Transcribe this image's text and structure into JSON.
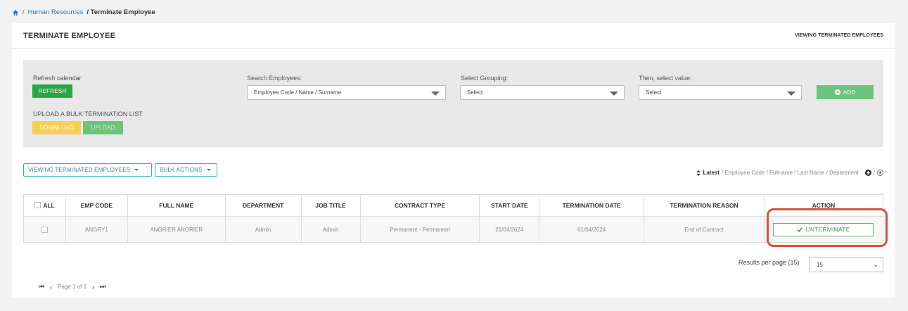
{
  "breadcrumb": {
    "separator": "/",
    "link": "Human Resources",
    "current": "/ Terminate Employee"
  },
  "card": {
    "title": "TERMINATE EMPLOYEE",
    "subtitle": "VIEWING TERMINATED EMPLOYEES"
  },
  "filters": {
    "refresh_label": "Refresh calendar",
    "refresh_button": "REFRESH",
    "upload_label": "UPLOAD A BULK TERMINATION LIST",
    "download_button": "DOWNLOAD",
    "upload_button": "UPLOAD",
    "search_label": "Search Employees:",
    "search_value": "Employee Code / Name / Surname",
    "grouping_label": "Select Grouping:",
    "grouping_value": "Select",
    "value_label": "Then, select value:",
    "value_value": "Select",
    "add_button": "ADD"
  },
  "toolbar": {
    "view_dropdown": "VIEWING TERMINATED EMPLOYEES",
    "bulk_dropdown": "BULK ACTIONS"
  },
  "sort": {
    "active": "Latest",
    "options": "/ Employee Code / Fullname / Last Name / Department",
    "separator": "/"
  },
  "table": {
    "headers": [
      "ALL",
      "EMP CODE",
      "FULL NAME",
      "DEPARTMENT",
      "JOB TITLE",
      "CONTRACT TYPE",
      "START DATE",
      "TERMINATION DATE",
      "TERMINATION REASON",
      "ACTION"
    ],
    "rows": [
      {
        "emp_code": "ANGRY1",
        "full_name": "ANGRIER ANGRIER",
        "department": "Admin",
        "job_title": "Admin",
        "contract_type": "Permanent - Permanent",
        "start_date": "21/04/2024",
        "termination_date": "01/04/2024",
        "termination_reason": "End of Contract",
        "action": "UNTERMINATE"
      }
    ]
  },
  "pagination": {
    "page_text": "Page 1 of 1",
    "results_label": "Results per page (15)",
    "results_value": "15"
  },
  "colors": {
    "green": "#28a745",
    "teal": "#2eb1c4",
    "highlight": "#d9503c",
    "yellow": "#f7cf55"
  }
}
